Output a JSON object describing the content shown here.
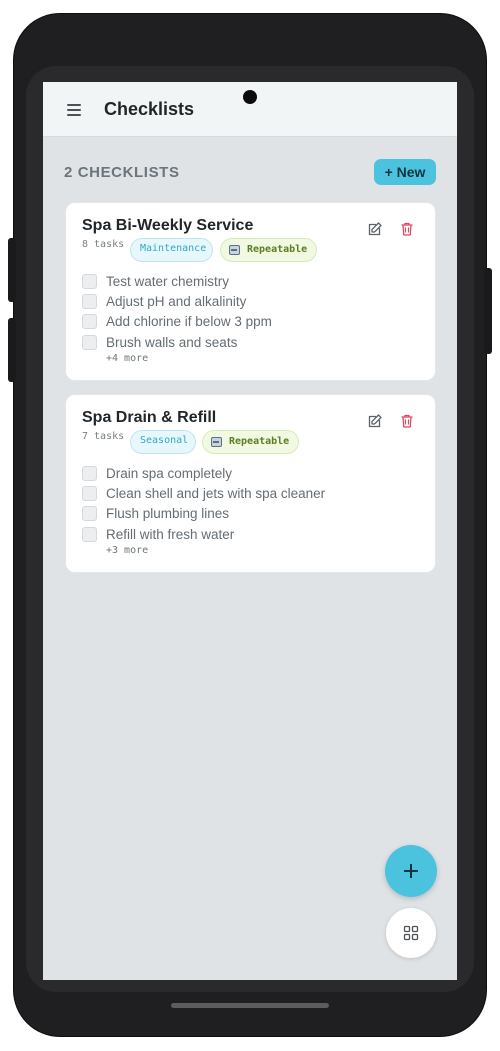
{
  "appbar": {
    "title": "Checklists"
  },
  "summary": {
    "count_label": "2 CHECKLISTS",
    "new_button": "+ New"
  },
  "checklists": [
    {
      "title": "Spa Bi-Weekly Service",
      "task_count": "8 tasks",
      "category": "Maintenance",
      "repeat_label": "Repeatable",
      "items": [
        "Test water chemistry",
        "Adjust pH and alkalinity",
        "Add chlorine if below 3 ppm",
        "Brush walls and seats"
      ],
      "more": "+4 more"
    },
    {
      "title": "Spa Drain & Refill",
      "task_count": "7 tasks",
      "category": "Seasonal",
      "repeat_label": "Repeatable",
      "items": [
        "Drain spa completely",
        "Clean shell and jets with spa cleaner",
        "Flush plumbing lines",
        "Refill with fresh water"
      ],
      "more": "+3 more"
    }
  ],
  "icons": {
    "menu": "hamburger-icon",
    "edit": "edit-icon",
    "delete": "trash-icon",
    "repeat": "repeat-icon",
    "add": "plus-icon",
    "grid": "grid-icon"
  },
  "colors": {
    "accent": "#4bc3df",
    "delete": "#e0485a",
    "screen_bg": "#dfe3e6"
  }
}
